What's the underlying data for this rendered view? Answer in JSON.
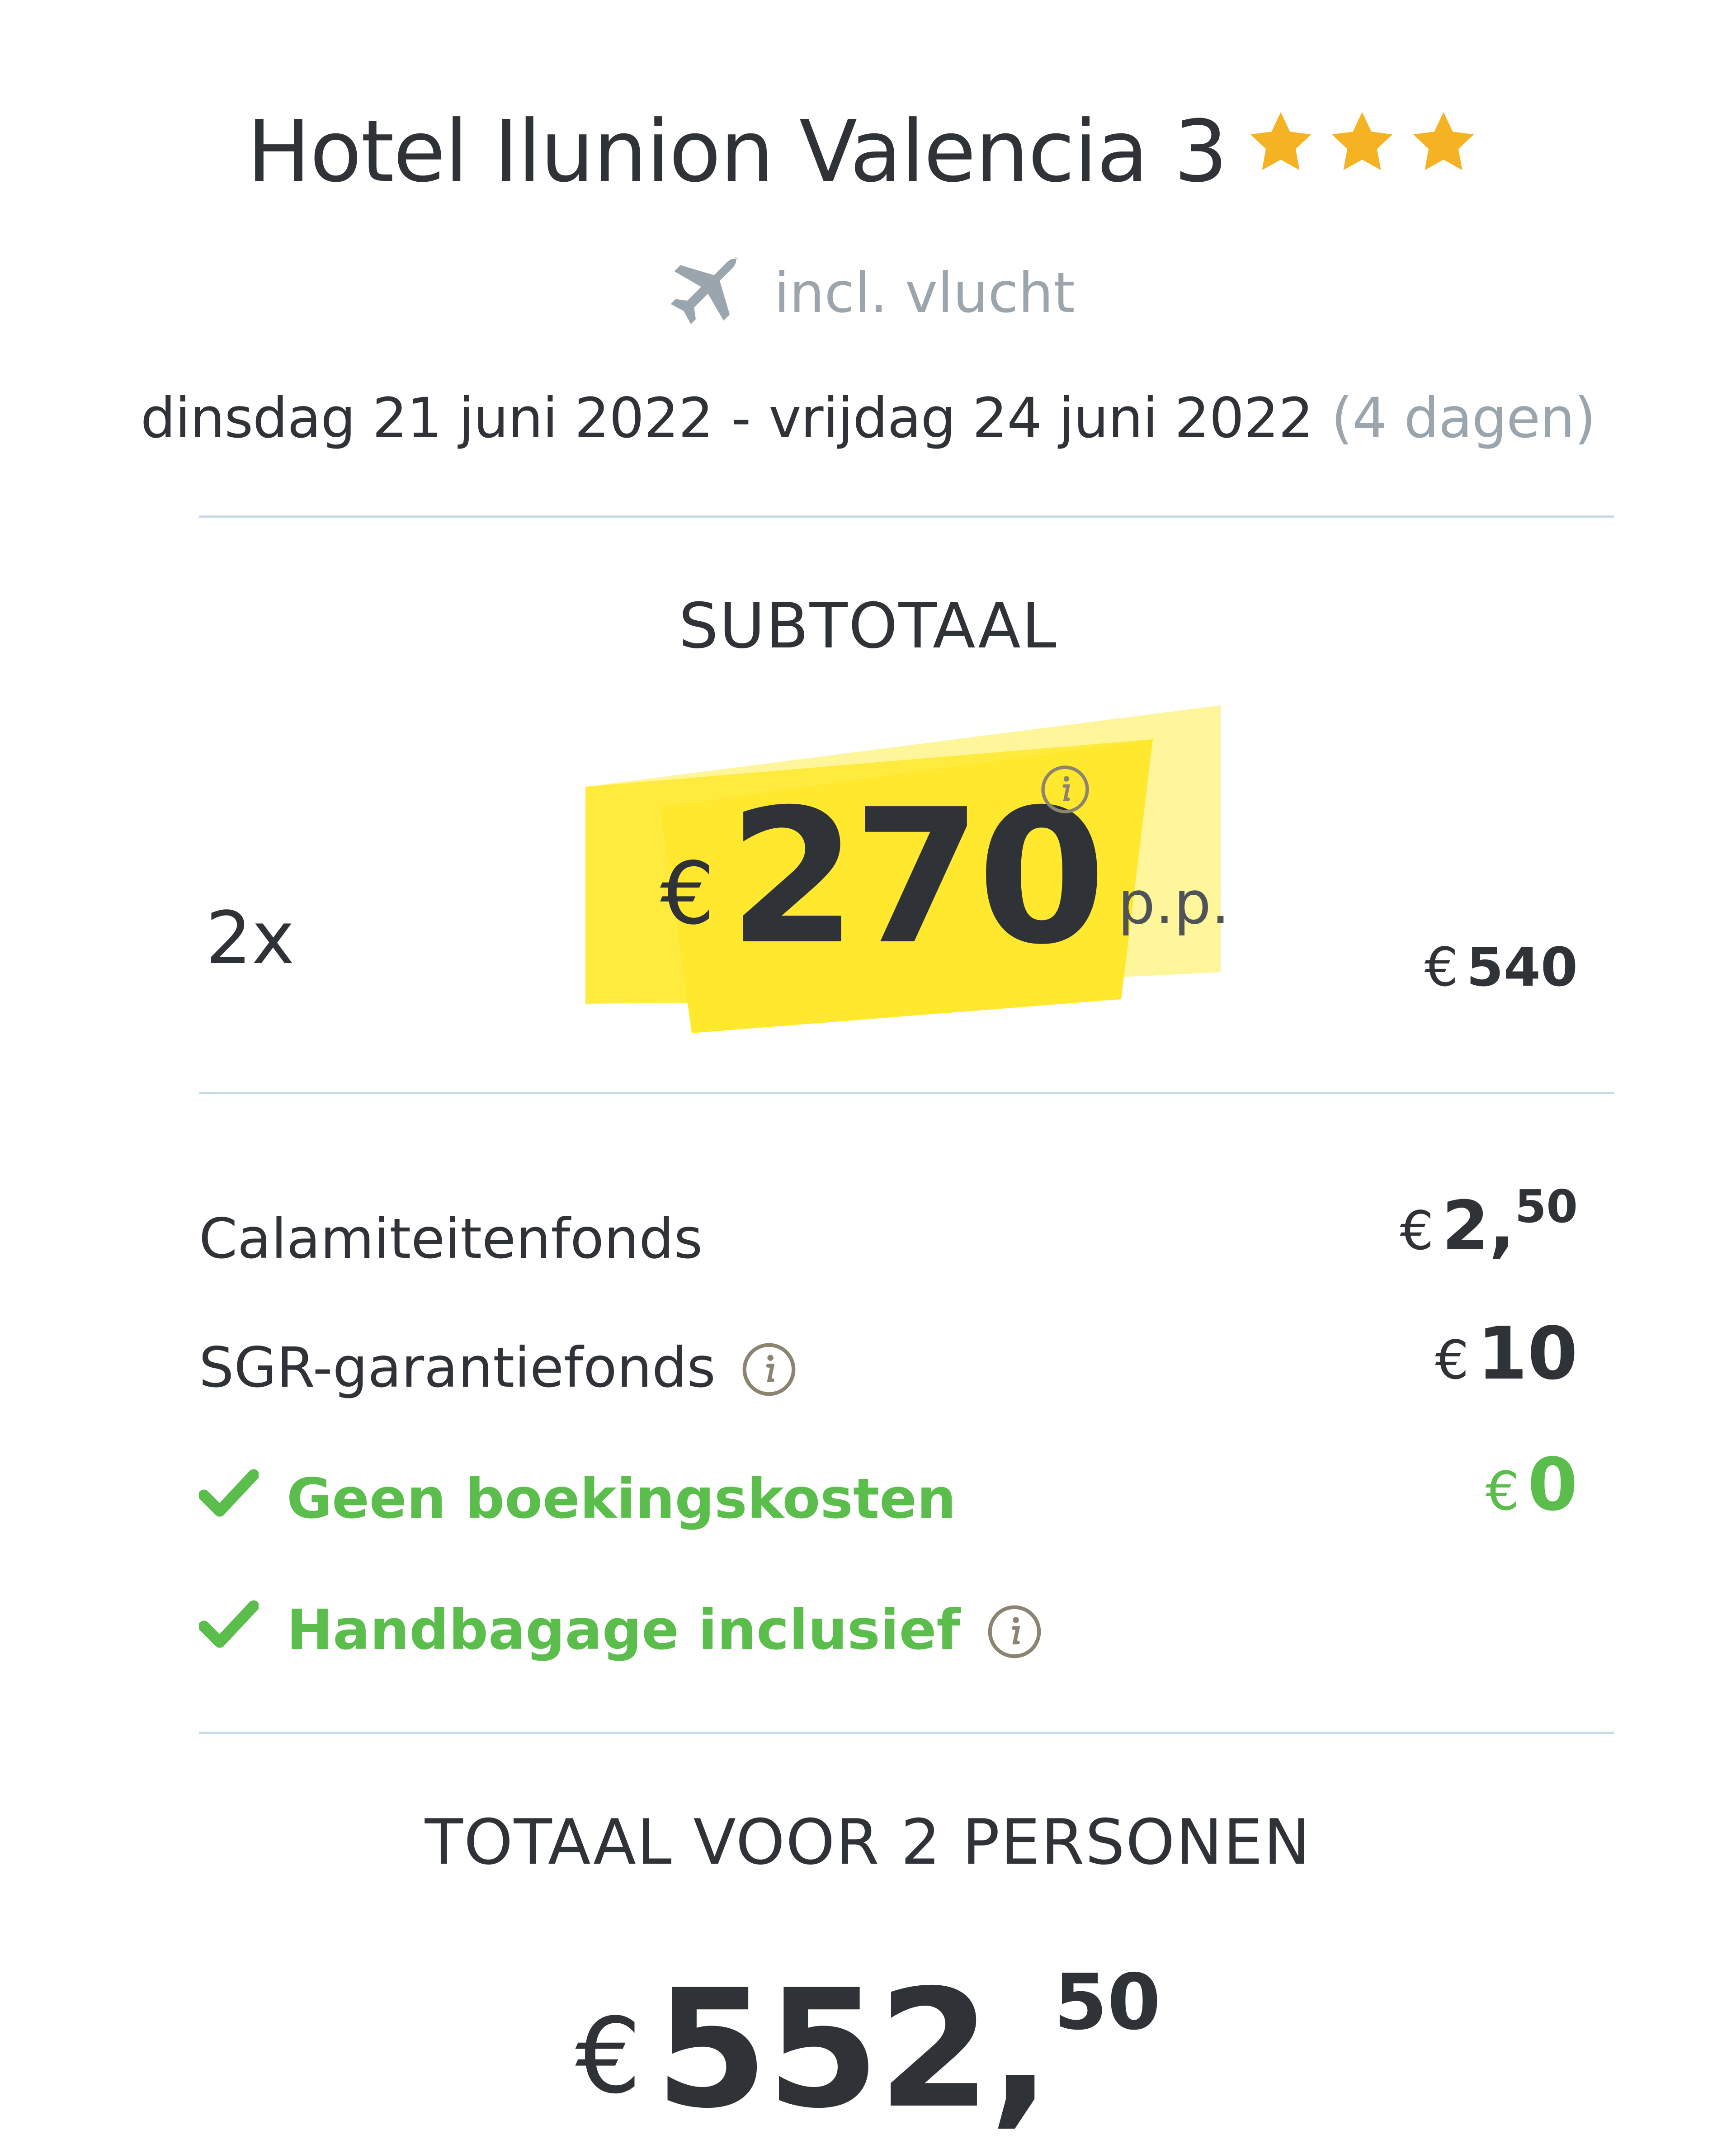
{
  "header": {
    "hotel_name": "Hotel Ilunion Valencia 3",
    "star_rating": 3,
    "star_color": "#f5b223",
    "flight_icon": "airplane-icon",
    "flight_label": "incl. vlucht",
    "date_from": "dinsdag 21 juni 2022",
    "date_separator": "-",
    "date_to": "vrijdag 24 juni 2022",
    "duration": "(4 dagen)"
  },
  "subtotal": {
    "title": "SUBTOTAAL",
    "quantity": "2x",
    "currency": "€",
    "price_per_person": "270",
    "per_person_label": "p.p.",
    "line_total": "540",
    "highlight_color": "#ffe82e"
  },
  "fees": [
    {
      "label": "Calamiteitenfonds",
      "currency": "€",
      "amount": "2,",
      "amount_decimals": "50",
      "has_info": false
    },
    {
      "label": "SGR-garantiefonds",
      "currency": "€",
      "amount": "10",
      "amount_decimals": "",
      "has_info": true
    }
  ],
  "included": [
    {
      "label": "Geen boekingskosten",
      "currency": "€",
      "amount": "0",
      "has_info": false
    },
    {
      "label": "Handbagage inclusief",
      "has_info": true
    }
  ],
  "total": {
    "title": "TOTAAL VOOR 2 PERSONEN",
    "currency": "€",
    "amount": "552,",
    "amount_decimals": "50"
  },
  "colors": {
    "text": "#2f3338",
    "muted": "#9aa5ae",
    "green": "#5bbd4b",
    "divider": "#c7dbe6"
  }
}
